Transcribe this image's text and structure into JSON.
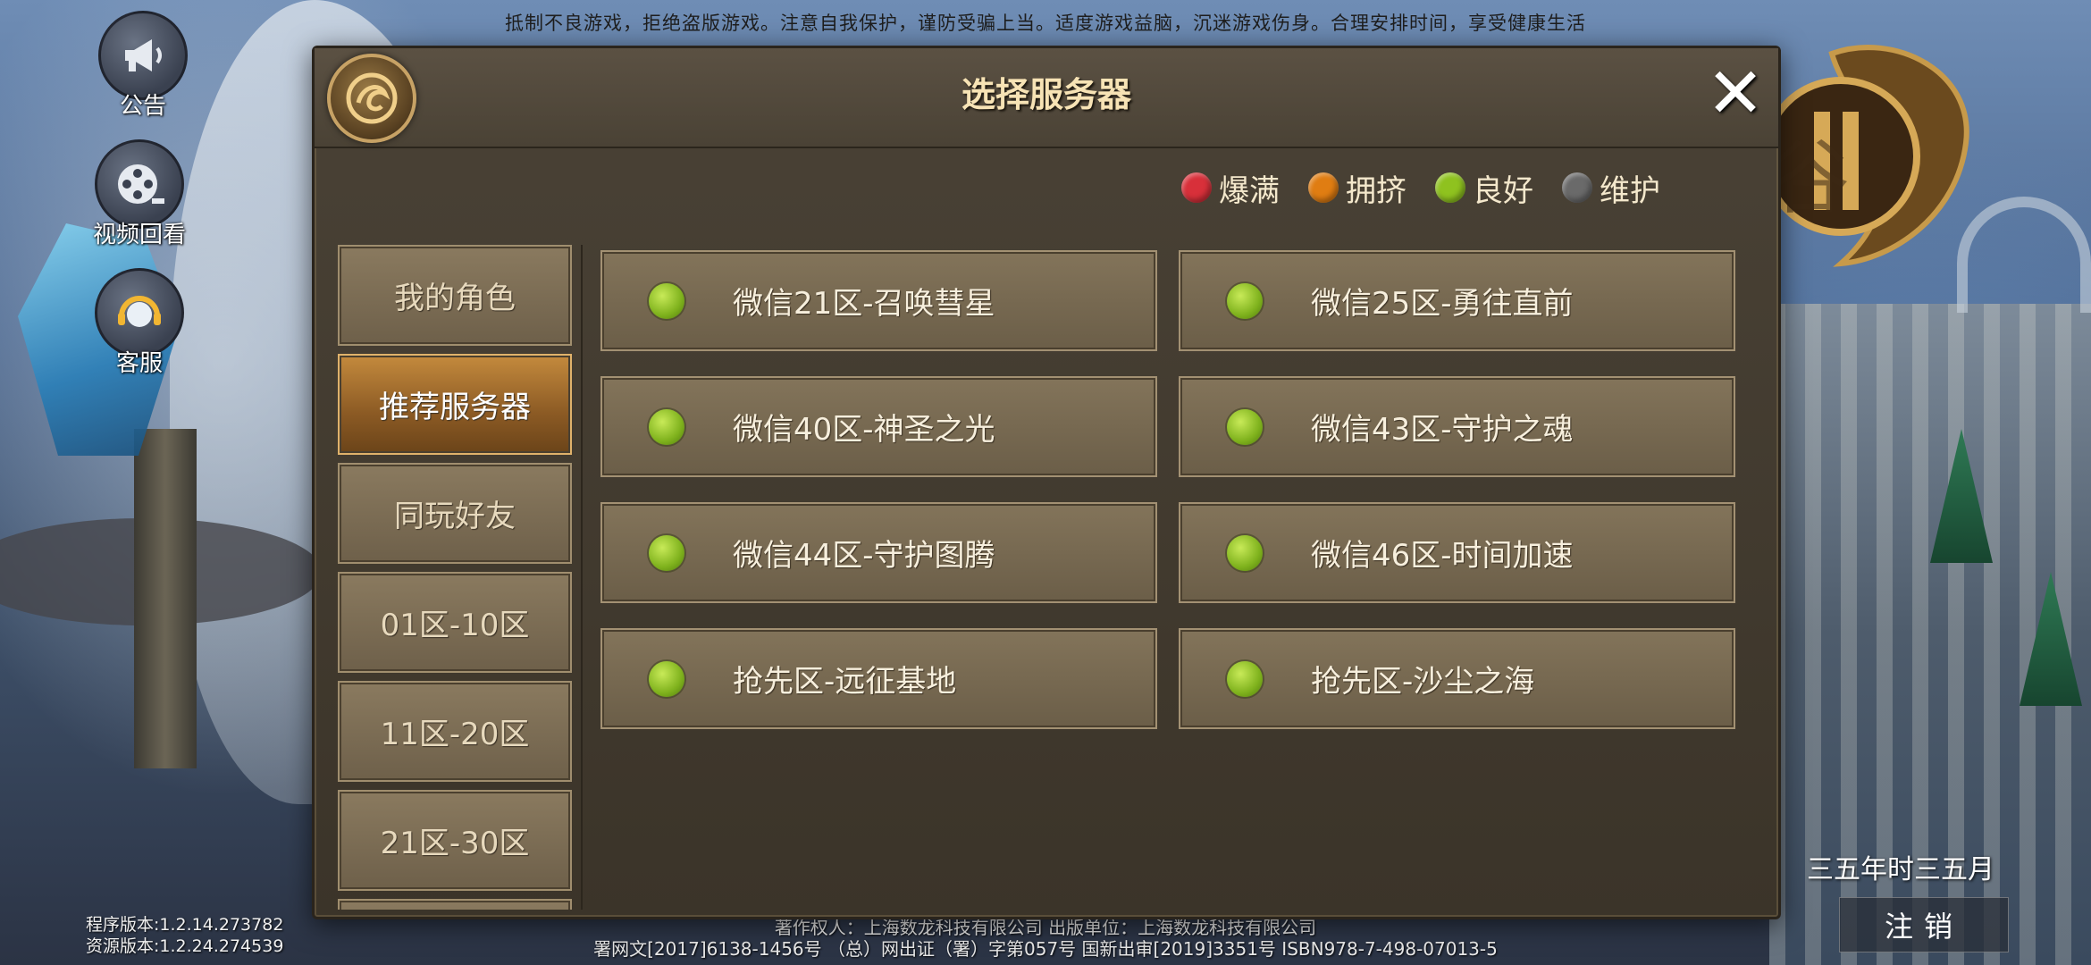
{
  "notice": "抵制不良游戏，拒绝盗版游戏。注意自我保护，谨防受骗上当。适度游戏益脑，沉迷游戏伤身。合理安排时间，享受健康生活",
  "side_buttons": [
    {
      "label": "公告",
      "icon": "megaphone-icon"
    },
    {
      "label": "视频回看",
      "icon": "film-reel-icon"
    },
    {
      "label": "客服",
      "icon": "headset-icon"
    }
  ],
  "version": {
    "program": "程序版本:1.2.14.273782",
    "resource": "资源版本:1.2.24.274539"
  },
  "footer": {
    "line1": "著作权人：上海数龙科技有限公司  出版单位：上海数龙科技有限公司",
    "line2": "署网文[2017]6138-1456号  （总）网出证（署）字第057号  国新出审[2019]3351号  ISBN978-7-498-07013-5"
  },
  "season": "三五年时三五月",
  "logout_label": "注销",
  "dialog": {
    "title": "选择服务器",
    "close_icon": "close-icon",
    "legend": [
      {
        "label": "爆满",
        "color": "#d8303a"
      },
      {
        "label": "拥挤",
        "color": "#e07d12"
      },
      {
        "label": "良好",
        "color": "#8fc21f"
      },
      {
        "label": "维护",
        "color": "#6a6a6a"
      }
    ],
    "tabs": [
      {
        "label": "我的角色",
        "active": false
      },
      {
        "label": "推荐服务器",
        "active": true
      },
      {
        "label": "同玩好友",
        "active": false
      },
      {
        "label": "01区-10区",
        "active": false
      },
      {
        "label": "11区-20区",
        "active": false
      },
      {
        "label": "21区-30区",
        "active": false
      }
    ],
    "servers": [
      {
        "name": "微信21区-召唤彗星",
        "status": "良好"
      },
      {
        "name": "微信25区-勇往直前",
        "status": "良好"
      },
      {
        "name": "微信40区-神圣之光",
        "status": "良好"
      },
      {
        "name": "微信43区-守护之魂",
        "status": "良好"
      },
      {
        "name": "微信44区-守护图腾",
        "status": "良好"
      },
      {
        "name": "微信46区-时间加速",
        "status": "良好"
      },
      {
        "name": "抢先区-远征基地",
        "status": "良好"
      },
      {
        "name": "抢先区-沙尘之海",
        "status": "良好"
      }
    ]
  }
}
